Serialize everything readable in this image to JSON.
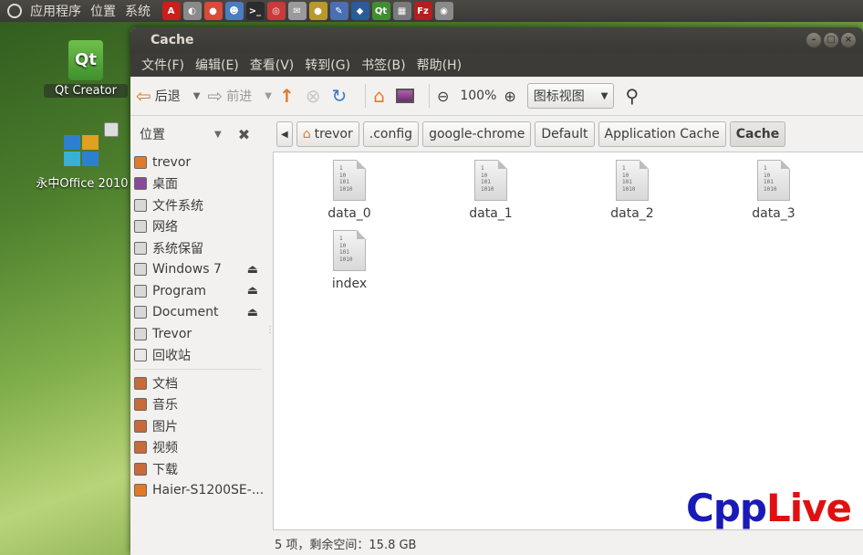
{
  "top_panel": {
    "menus": [
      "应用程序",
      "位置",
      "系统"
    ],
    "launchers": [
      {
        "icon": "acrobat-icon",
        "color": "#c8201a",
        "glyph": "A"
      },
      {
        "icon": "disk-icon",
        "color": "#8a8a8a",
        "glyph": "◐"
      },
      {
        "icon": "chrome-icon",
        "color": "#d94a38",
        "glyph": "●"
      },
      {
        "icon": "contacts-icon",
        "color": "#4a7cc4",
        "glyph": "☻"
      },
      {
        "icon": "terminal-icon",
        "color": "#2c2c2c",
        "glyph": ">_"
      },
      {
        "icon": "rhythmbox-icon",
        "color": "#c93a3a",
        "glyph": "◎"
      },
      {
        "icon": "mail-icon",
        "color": "#9a9a9a",
        "glyph": "✉"
      },
      {
        "icon": "music-player-icon",
        "color": "#b89a2a",
        "glyph": "●"
      },
      {
        "icon": "notes-icon",
        "color": "#4a6fb5",
        "glyph": "✎"
      },
      {
        "icon": "virtualbox-icon",
        "color": "#2a5b9a",
        "glyph": "◆"
      },
      {
        "icon": "qt-icon",
        "color": "#3f8f2f",
        "glyph": "Qt"
      },
      {
        "icon": "calculator-icon",
        "color": "#7a7a7a",
        "glyph": "▦"
      },
      {
        "icon": "filezilla-icon",
        "color": "#b41e1e",
        "glyph": "Fz"
      },
      {
        "icon": "screenshot-icon",
        "color": "#8a8a8a",
        "glyph": "◉"
      }
    ]
  },
  "desktop": {
    "icons": [
      {
        "label": "Qt Creator"
      },
      {
        "label": "永中Office 2010"
      }
    ]
  },
  "window": {
    "title": "Cache",
    "menu": [
      "文件(F)",
      "编辑(E)",
      "查看(V)",
      "转到(G)",
      "书签(B)",
      "帮助(H)"
    ],
    "toolbar": {
      "back_label": "后退",
      "forward_label": "前进",
      "zoom_level": "100%",
      "view_mode": "图标视图"
    },
    "places_label": "位置",
    "breadcrumbs": [
      "trevor",
      ".config",
      "google-chrome",
      "Default",
      "Application Cache",
      "Cache"
    ],
    "sidebar": {
      "items": [
        {
          "label": "trevor",
          "icon": "home-folder-icon",
          "eject": false
        },
        {
          "label": "桌面",
          "icon": "desktop-icon",
          "eject": false
        },
        {
          "label": "文件系统",
          "icon": "drive-icon",
          "eject": false
        },
        {
          "label": "网络",
          "icon": "network-icon",
          "eject": false
        },
        {
          "label": "系统保留",
          "icon": "drive-icon",
          "eject": false
        },
        {
          "label": "Windows 7",
          "icon": "drive-icon",
          "eject": true
        },
        {
          "label": "Program",
          "icon": "drive-icon",
          "eject": true
        },
        {
          "label": "Document",
          "icon": "drive-icon",
          "eject": true
        },
        {
          "label": "Trevor",
          "icon": "drive-icon",
          "eject": false
        },
        {
          "label": "回收站",
          "icon": "trash-icon",
          "eject": false
        }
      ],
      "bookmarks": [
        {
          "label": "文档",
          "icon": "documents-folder-icon"
        },
        {
          "label": "音乐",
          "icon": "music-folder-icon"
        },
        {
          "label": "图片",
          "icon": "pictures-folder-icon"
        },
        {
          "label": "视频",
          "icon": "videos-folder-icon"
        },
        {
          "label": "下载",
          "icon": "downloads-folder-icon"
        },
        {
          "label": "Haier-S1200SE-...",
          "icon": "folder-icon"
        }
      ]
    },
    "files": [
      {
        "name": "data_0"
      },
      {
        "name": "data_1"
      },
      {
        "name": "data_2"
      },
      {
        "name": "data_3"
      },
      {
        "name": "index"
      }
    ],
    "status": "5 项，剩余空间：15.8 GB"
  },
  "watermark": {
    "text_a": "Cpp",
    "text_b": "Live",
    "color_a": "#1a1ab8",
    "color_b": "#e01010"
  }
}
